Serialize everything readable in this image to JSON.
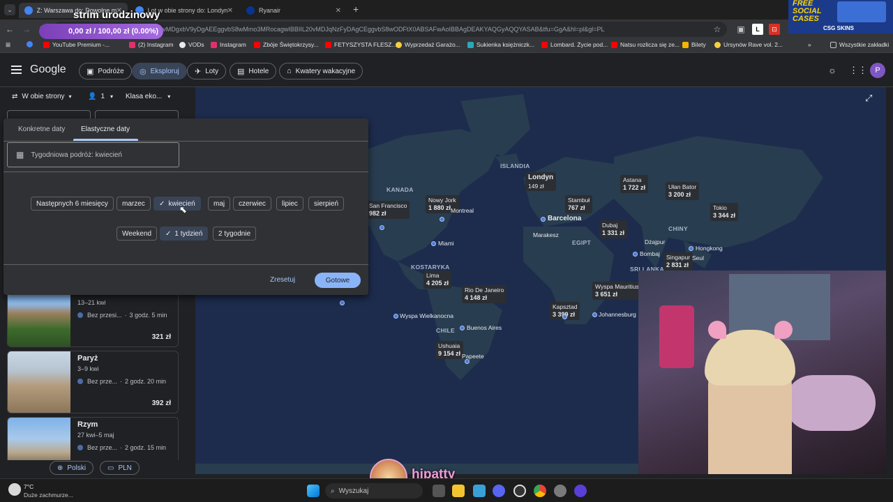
{
  "browser": {
    "tabs": [
      {
        "title": "Z: Warszawa do: Dowolne mie...",
        "active": true
      },
      {
        "title": "Lot w obie strony do: Londyn |",
        "active": false
      },
      {
        "title": "Ryanair",
        "active": false
      }
    ],
    "url": "...2tfs=CBwQAxocagwIAhIIL20vMDgxbV9yDgAEEggvbS8wMmo3MRocagwIBBIIL20vMDJqNzFyDAgCEggvbS8wODFtX0ABSAFwAoIBBAgDEAKYAQGyAQQYASAB&tfu=GgA&hl=pl&gl=PL",
    "bookmarks": [
      "YouTube Premium -...",
      "(2) Instagram",
      "VODs",
      "Instagram",
      "Zbóje Świętokrzysy...",
      "FETYSZYSTA FLESZ...",
      "Wyprzedaż Garażo...",
      "Sukienka księżniczk...",
      "Lombard. Życie pod...",
      "Natsu rozlicza się ze...",
      "Bilety",
      "Ursynów Rave vol. 2...",
      "Wszystkie zakładki"
    ]
  },
  "overlay": {
    "stream_title": "strim urodzinowy",
    "donation": "0,00 zł / 100,00 zł (0.00%)",
    "promo_line1": "FREE",
    "promo_line2": "SOCIAL",
    "promo_line3": "CASES",
    "promo_brand": "CSG SKINS",
    "streamer": "hipatty"
  },
  "google": {
    "logo": "Google",
    "nav": [
      "Podróże",
      "Eksploruj",
      "Loty",
      "Hotele",
      "Kwatery wakacyjne"
    ],
    "avatar": "P"
  },
  "search": {
    "trip_type": "W obie strony",
    "passengers": "1",
    "cabin": "Klasa eko..."
  },
  "dates_panel": {
    "tabs": [
      "Konkretne daty",
      "Elastyczne daty"
    ],
    "field": "Tygodniowa podróż: kwiecień",
    "months": [
      "Następnych 6 miesięcy",
      "marzec",
      "kwiecień",
      "maj",
      "czerwiec",
      "lipiec",
      "sierpień"
    ],
    "durations": [
      "Weekend",
      "1 tydzień",
      "2 tygodnie"
    ],
    "reset": "Zresetuj",
    "done": "Gotowe"
  },
  "results": [
    {
      "city": "Barcelona",
      "dates": "13–21 kwi",
      "stops": "Bez przesi...",
      "duration": "3 godz. 5 min",
      "price": "321 zł"
    },
    {
      "city": "Paryż",
      "dates": "3–9 kwi",
      "stops": "Bez prze...",
      "duration": "2 godz. 20 min",
      "price": "392 zł"
    },
    {
      "city": "Rzym",
      "dates": "27 kwi–5 maj",
      "stops": "Bez prze...",
      "duration": "2 godz. 15 min",
      "price": ""
    }
  ],
  "footer": {
    "language": "Polski",
    "currency": "PLN"
  },
  "map": {
    "countries": [
      "ISLANDIA",
      "KANADA",
      "KOSTARYKA",
      "CHILE",
      "EGIPT",
      "CHINY",
      "SRI LANKA"
    ],
    "destinations": [
      {
        "city": "Londyn",
        "price": "149 zł"
      },
      {
        "city": "Nowy Jork",
        "price": "1 880 zł"
      },
      {
        "city": "San Francisco",
        "price": "982 zł"
      },
      {
        "city": "Stambuł",
        "price": "767 zł"
      },
      {
        "city": "Astana",
        "price": "1 722 zł"
      },
      {
        "city": "Ułan Bator",
        "price": "3 200 zł"
      },
      {
        "city": "Tokio",
        "price": "3 344 zł"
      },
      {
        "city": "Dubaj",
        "price": "1 331 zł"
      },
      {
        "city": "Singapur",
        "price": "2 831 zł"
      },
      {
        "city": "Lima",
        "price": "4 205 zł"
      },
      {
        "city": "Rio De Janeiro",
        "price": "4 148 zł"
      },
      {
        "city": "Wyspa Mauritius",
        "price": "3 651 zł"
      },
      {
        "city": "Kapsztad",
        "price": "3 399 zł"
      },
      {
        "city": "Ushuaia",
        "price": "9 154 zł"
      }
    ],
    "places": [
      "Barcelona",
      "Miami",
      "Marakesz",
      "Dżajpur",
      "Bombaj",
      "Hongkong",
      "Wyspa Wielkanocna",
      "Buenos Aires",
      "Johannesburg",
      "Montreal",
      "Seul",
      "Papeete"
    ]
  },
  "taskbar": {
    "weather_temp": "7°C",
    "weather_desc": "Duże zachmurze...",
    "search": "Wyszukaj"
  }
}
